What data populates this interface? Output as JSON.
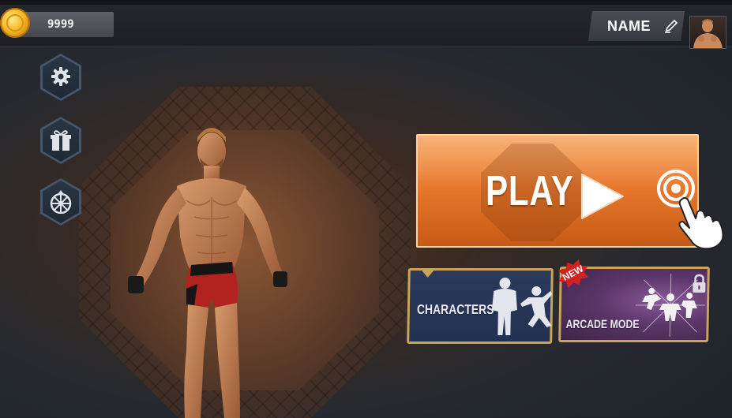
{
  "header": {
    "coins": "9999",
    "player_name": "NAME"
  },
  "sidebar": {
    "items": [
      {
        "name": "settings",
        "icon": "gear-icon"
      },
      {
        "name": "gift",
        "icon": "gift-icon"
      },
      {
        "name": "spin-wheel",
        "icon": "wheel-icon"
      }
    ]
  },
  "main": {
    "play_label": "PLAY",
    "modes": [
      {
        "label": "CHARACTERS"
      },
      {
        "label": "ARCADE MODE",
        "badge": "NEW",
        "locked": true
      }
    ]
  },
  "colors": {
    "play_orange": "#e8792c",
    "card_border": "#c9a45a",
    "characters_bg": "#2c3a5c",
    "arcade_bg": "#5a3668",
    "new_badge": "#d42020"
  }
}
